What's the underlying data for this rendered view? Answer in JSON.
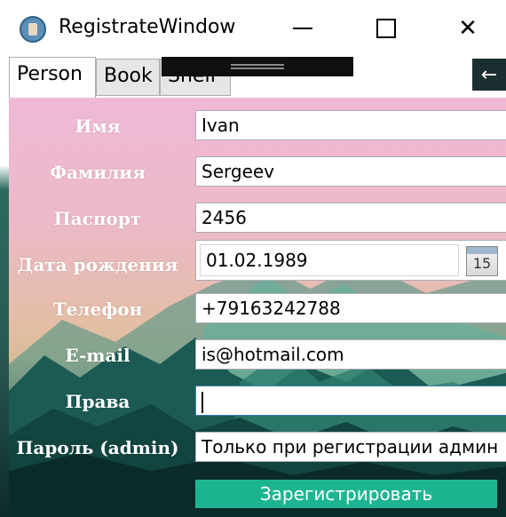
{
  "window": {
    "title": "RegistrateWindow"
  },
  "tabs": [
    {
      "label": "Person"
    },
    {
      "label": "Book"
    },
    {
      "label": "Shelf"
    }
  ],
  "back_button": {
    "symbol": "←"
  },
  "form": {
    "first_name_label": "Имя",
    "first_name_value": "Ivan",
    "last_name_label": "Фамилия",
    "last_name_value": "Sergeev",
    "passport_label": "Паспорт",
    "passport_value": "2456",
    "birthdate_label": "Дата рождения",
    "birthdate_value": "01.02.1989",
    "calendar_day": "15",
    "phone_label": "Телефон",
    "phone_value": "+79163242788",
    "email_label": "E-mail",
    "email_value": "is@hotmail.com",
    "rights_label": "Права",
    "rights_value": "",
    "password_label": "Пароль (admin)",
    "password_value": "Только при регистрации админ",
    "submit_label": "Зарегистрировать"
  },
  "colors": {
    "accent": "#1db591",
    "panel_top": "#efb9d6",
    "panel_bottom": "#0f2f2c"
  }
}
